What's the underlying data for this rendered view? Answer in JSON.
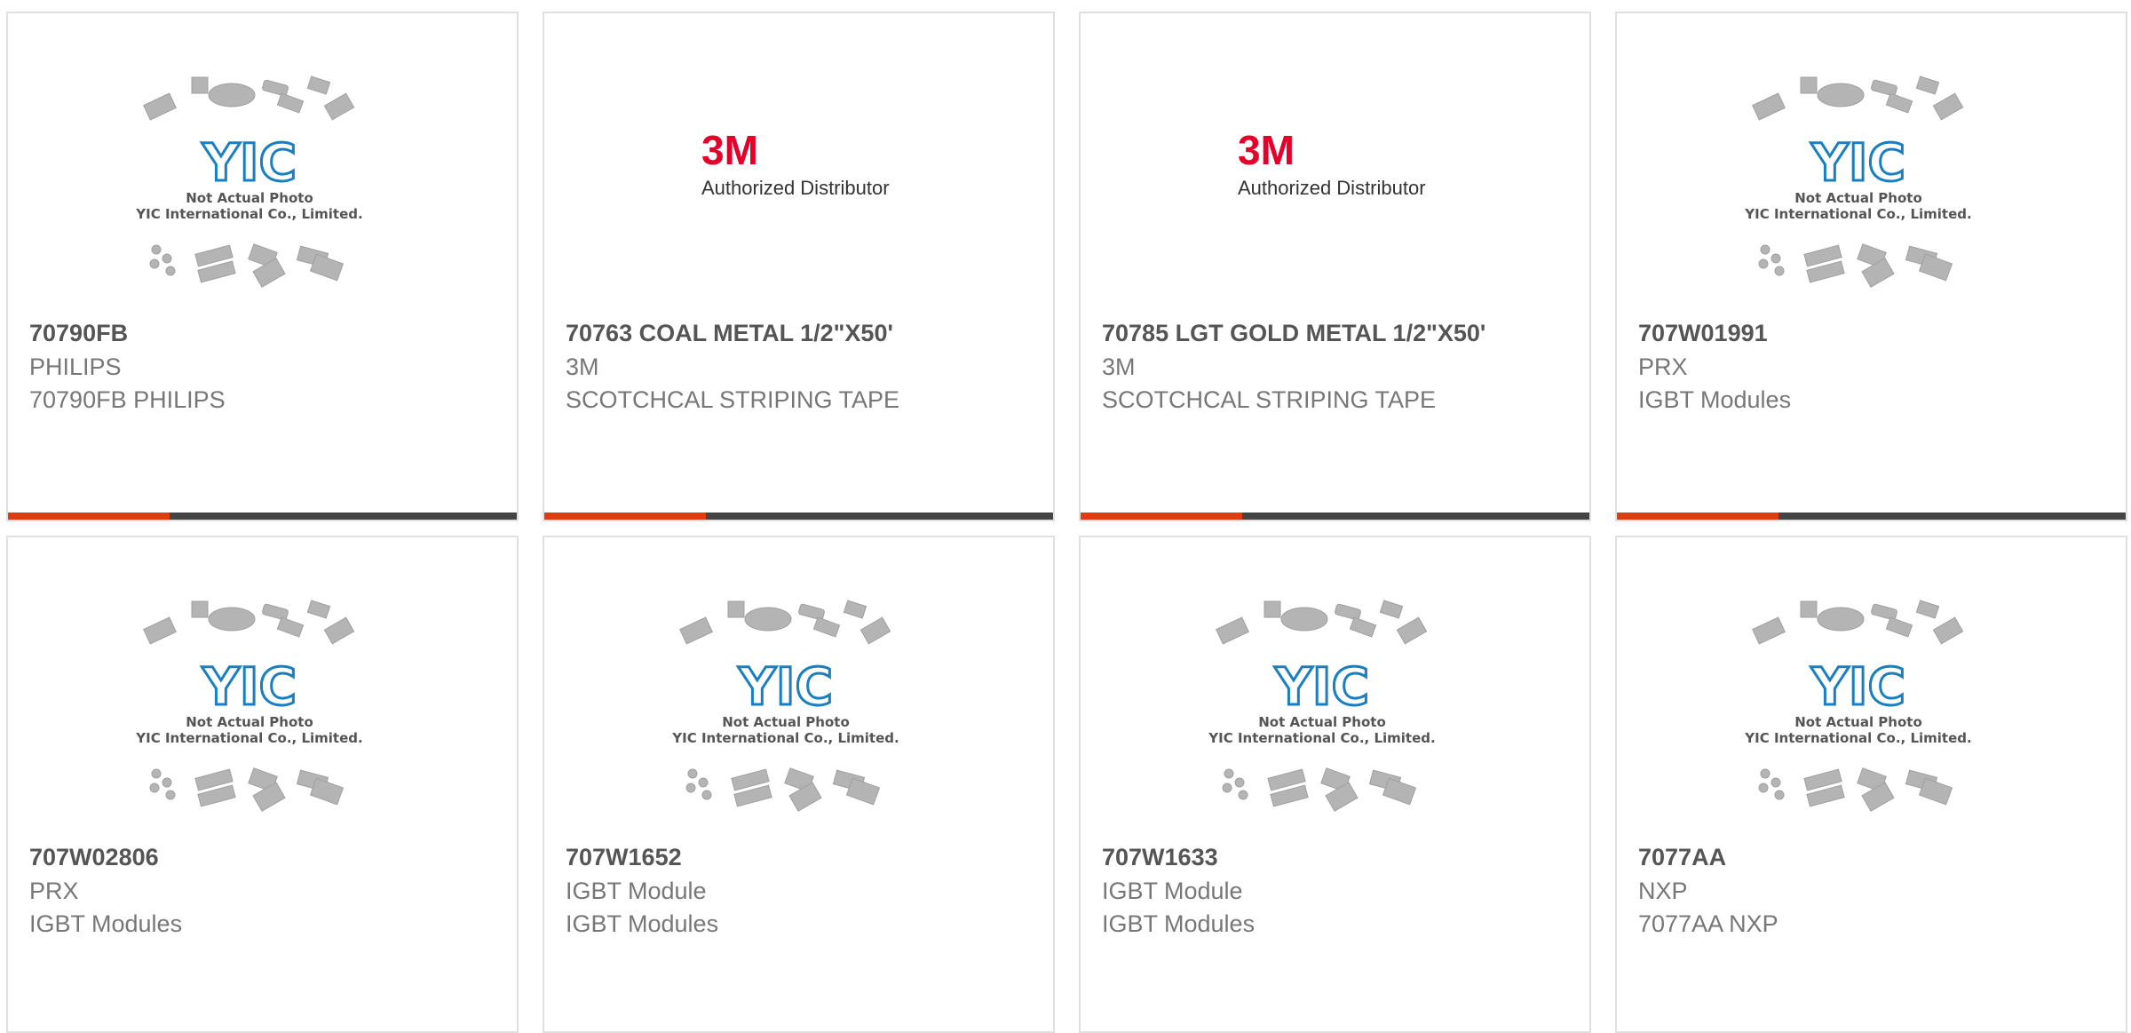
{
  "products": [
    {
      "image": "yic",
      "title": "70790FB",
      "line2": "PHILIPS",
      "line3": "70790FB PHILIPS",
      "has_bar": true
    },
    {
      "image": "3m",
      "title": "70763 COAL METAL 1/2\"X50'",
      "line2": "3M",
      "line3": "SCOTCHCAL STRIPING TAPE",
      "has_bar": true
    },
    {
      "image": "3m",
      "title": "70785 LGT GOLD METAL 1/2\"X50'",
      "line2": "3M",
      "line3": "SCOTCHCAL STRIPING TAPE",
      "has_bar": true
    },
    {
      "image": "yic",
      "title": "707W01991",
      "line2": "PRX",
      "line3": "IGBT Modules",
      "has_bar": true
    },
    {
      "image": "yic",
      "title": "707W02806",
      "line2": "PRX",
      "line3": "IGBT Modules",
      "has_bar": false
    },
    {
      "image": "yic",
      "title": "707W1652",
      "line2": "IGBT Module",
      "line3": "IGBT Modules",
      "has_bar": false
    },
    {
      "image": "yic",
      "title": "707W1633",
      "line2": "IGBT Module",
      "line3": "IGBT Modules",
      "has_bar": false
    },
    {
      "image": "yic",
      "title": "7077AA",
      "line2": "NXP",
      "line3": "7077AA NXP",
      "has_bar": false
    }
  ],
  "placeholder_yic": {
    "logo": "YIC",
    "caption_1": "Not Actual Photo",
    "caption_2": "YIC International Co., Limited."
  },
  "placeholder_3m": {
    "logo": "3M",
    "caption": "Authorized Distributor"
  },
  "colors": {
    "accent": "#e03c13",
    "bar": "#444444",
    "title": "#555555",
    "text": "#777777",
    "yic_blue": "#1a7fc1",
    "brand_3m": "#e4002b"
  }
}
